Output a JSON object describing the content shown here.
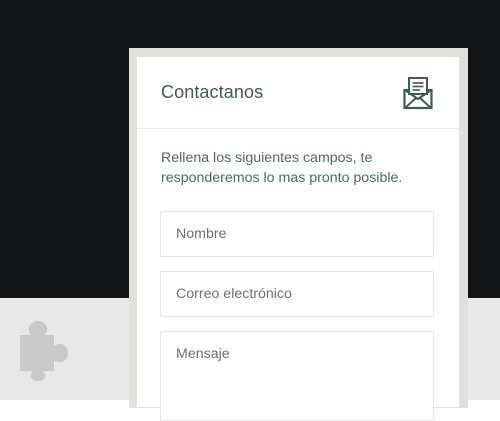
{
  "background": {
    "dark_color": "#131416",
    "light_color": "#e8e8e8",
    "extension_icon": "puzzle-piece-icon"
  },
  "contact_form": {
    "title": "Contactanos",
    "header_icon": "envelope-letter-icon",
    "intro_text": "Rellena los siguientes campos, te responderemos lo mas pronto posible.",
    "fields": {
      "name_placeholder": "Nombre",
      "email_placeholder": "Correo electrónico",
      "message_placeholder": "Mensaje"
    },
    "accent_color": "#3f5c51"
  }
}
